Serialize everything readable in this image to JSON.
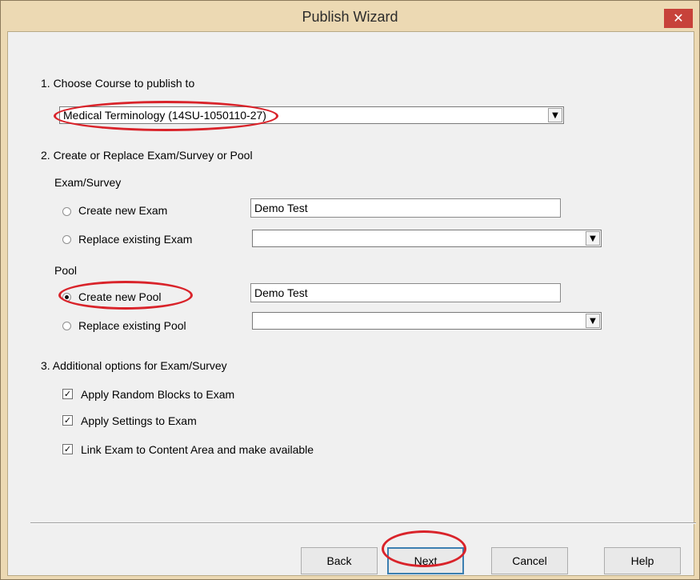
{
  "window": {
    "title": "Publish Wizard",
    "close_glyph": "✕"
  },
  "section1": {
    "heading": "1. Choose Course to publish to",
    "course_value": "Medical Terminology (14SU-1050110-27)"
  },
  "section2": {
    "heading": "2. Create or Replace Exam/Survey or Pool",
    "exam_group": "Exam/Survey",
    "create_exam_label": "Create new Exam",
    "create_exam_value": "Demo Test",
    "create_exam_selected": false,
    "replace_exam_label": "Replace existing Exam",
    "replace_exam_value": "",
    "replace_exam_selected": false,
    "pool_group": "Pool",
    "create_pool_label": "Create new Pool",
    "create_pool_value": "Demo Test",
    "create_pool_selected": true,
    "replace_pool_label": "Replace existing Pool",
    "replace_pool_value": "",
    "replace_pool_selected": false
  },
  "section3": {
    "heading": "3. Additional options for Exam/Survey",
    "options": [
      {
        "label": "Apply Random Blocks to Exam",
        "checked": true
      },
      {
        "label": "Apply Settings to Exam",
        "checked": true
      },
      {
        "label": "Link Exam to Content Area and make available",
        "checked": true
      }
    ]
  },
  "buttons": {
    "back": "Back",
    "next": "Next",
    "cancel": "Cancel",
    "help": "Help"
  },
  "glyphs": {
    "dropdown": "▼",
    "check": "✓"
  },
  "colors": {
    "frame": "#ecd9b3",
    "close": "#c7423a",
    "annotation": "#d9232a"
  }
}
